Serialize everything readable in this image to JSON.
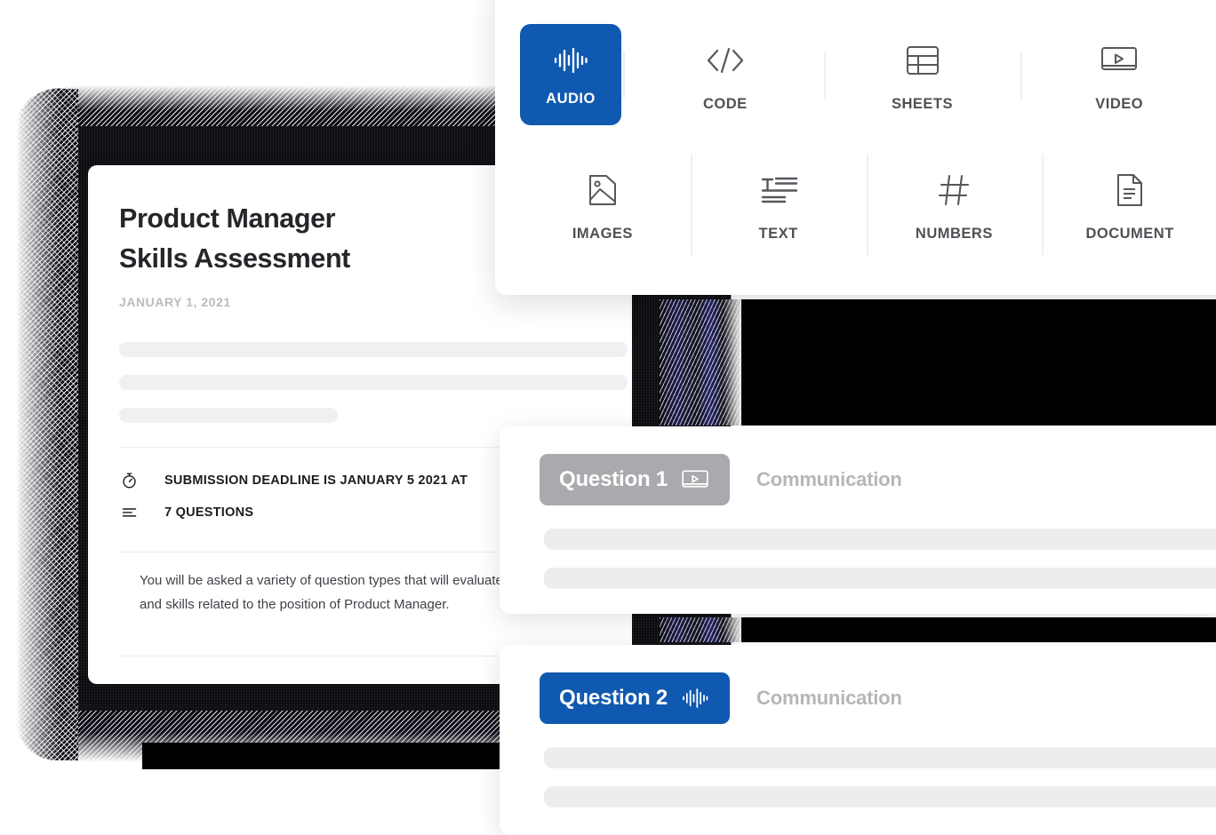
{
  "theme": {
    "accent_blue": "#1059b0",
    "badge_gray": "#a8aaad",
    "skeleton_gray": "#eceded",
    "dark_shape": "#0b0b10",
    "muted_text": "#b4b6b9"
  },
  "media_panel": {
    "name": "question-type-picker",
    "row1": [
      {
        "id": "audio",
        "label": "AUDIO",
        "icon": "audio-waveform-icon",
        "selected": true
      },
      {
        "id": "code",
        "label": "CODE",
        "icon": "code-brackets-icon",
        "selected": false
      },
      {
        "id": "sheets",
        "label": "SHEETS",
        "icon": "table-grid-icon",
        "selected": false
      },
      {
        "id": "video",
        "label": "VIDEO",
        "icon": "video-play-icon",
        "selected": false
      }
    ],
    "row2": [
      {
        "id": "images",
        "label": "IMAGES",
        "icon": "image-picture-icon",
        "selected": false
      },
      {
        "id": "text",
        "label": "TEXT",
        "icon": "text-lines-icon",
        "selected": false
      },
      {
        "id": "numbers",
        "label": "NUMBERS",
        "icon": "hash-number-icon",
        "selected": false
      },
      {
        "id": "document",
        "label": "DOCUMENT",
        "icon": "document-page-icon",
        "selected": false
      }
    ]
  },
  "assessment": {
    "title": "Product Manager\nSkills Assessment",
    "date": "JANUARY 1, 2021",
    "meta": [
      {
        "icon": "stopwatch-icon",
        "text": "SUBMISSION DEADLINE IS JANUARY 5 2021 AT"
      },
      {
        "icon": "list-lines-icon",
        "text": "7 QUESTIONS"
      }
    ],
    "body": "You will be asked a variety of question types that will evaluate\nand skills related to the position of Product Manager."
  },
  "questions": [
    {
      "badge_label": "Question 1",
      "badge_icon": "video-play-icon",
      "badge_color": "#a8aaad",
      "topic": "Communication"
    },
    {
      "badge_label": "Question 2",
      "badge_icon": "audio-waveform-icon",
      "badge_color": "#1059b0",
      "topic": "Communication"
    }
  ]
}
